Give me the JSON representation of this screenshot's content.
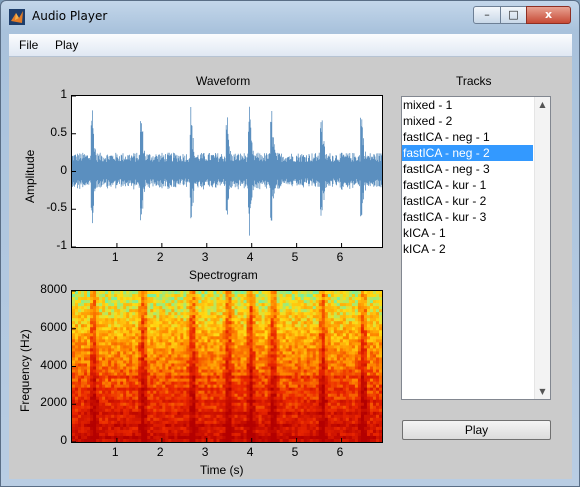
{
  "window": {
    "title": "Audio Player",
    "minimize_glyph": "–",
    "maximize_glyph": "□",
    "close_glyph": "x"
  },
  "menu": {
    "items": [
      "File",
      "Play"
    ]
  },
  "waveform": {
    "title": "Waveform",
    "ylabel": "Amplitude",
    "yticks": [
      "1",
      "0.5",
      "0",
      "-0.5",
      "-1"
    ],
    "xticks": [
      "1",
      "2",
      "3",
      "4",
      "5",
      "6"
    ]
  },
  "spectrogram": {
    "title": "Spectrogram",
    "ylabel": "Frequency (Hz)",
    "xlabel": "Time (s)",
    "yticks": [
      "8000",
      "6000",
      "4000",
      "2000",
      "0"
    ],
    "xticks": [
      "1",
      "2",
      "3",
      "4",
      "5",
      "6"
    ]
  },
  "tracks": {
    "title": "Tracks",
    "items": [
      "mixed - 1",
      "mixed - 2",
      "fastICA - neg - 1",
      "fastICA - neg - 2",
      "fastICA - neg - 3",
      "fastICA - kur - 1",
      "fastICA - kur - 2",
      "fastICA - kur - 3",
      "kICA - 1",
      "kICA - 2"
    ],
    "selected_index": 3
  },
  "play_button": {
    "label": "Play"
  },
  "colors": {
    "waveform": "#5b8fbf",
    "selection": "#3399ff"
  },
  "chart_data": [
    {
      "type": "line",
      "title": "Waveform",
      "ylabel": "Amplitude",
      "xlabel": "",
      "xlim": [
        0,
        6.9
      ],
      "ylim": [
        -1,
        1
      ],
      "x_ticks": [
        1,
        2,
        3,
        4,
        5,
        6
      ],
      "y_ticks": [
        -1,
        -0.5,
        0,
        0.5,
        1
      ],
      "bursts": [
        {
          "t": 0.45,
          "amp": 0.95
        },
        {
          "t": 1.55,
          "amp": 0.8
        },
        {
          "t": 2.65,
          "amp": 0.9
        },
        {
          "t": 3.45,
          "amp": 0.85
        },
        {
          "t": 3.95,
          "amp": 0.9
        },
        {
          "t": 4.45,
          "amp": 0.85
        },
        {
          "t": 5.55,
          "amp": 0.95
        },
        {
          "t": 6.45,
          "amp": 0.85
        }
      ],
      "baseline_amp": 0.25
    },
    {
      "type": "heatmap",
      "title": "Spectrogram",
      "ylabel": "Frequency (Hz)",
      "xlabel": "Time (s)",
      "xlim": [
        0,
        6.9
      ],
      "ylim": [
        0,
        8000
      ],
      "x_ticks": [
        1,
        2,
        3,
        4,
        5,
        6
      ],
      "y_ticks": [
        0,
        2000,
        4000,
        6000,
        8000
      ]
    }
  ]
}
